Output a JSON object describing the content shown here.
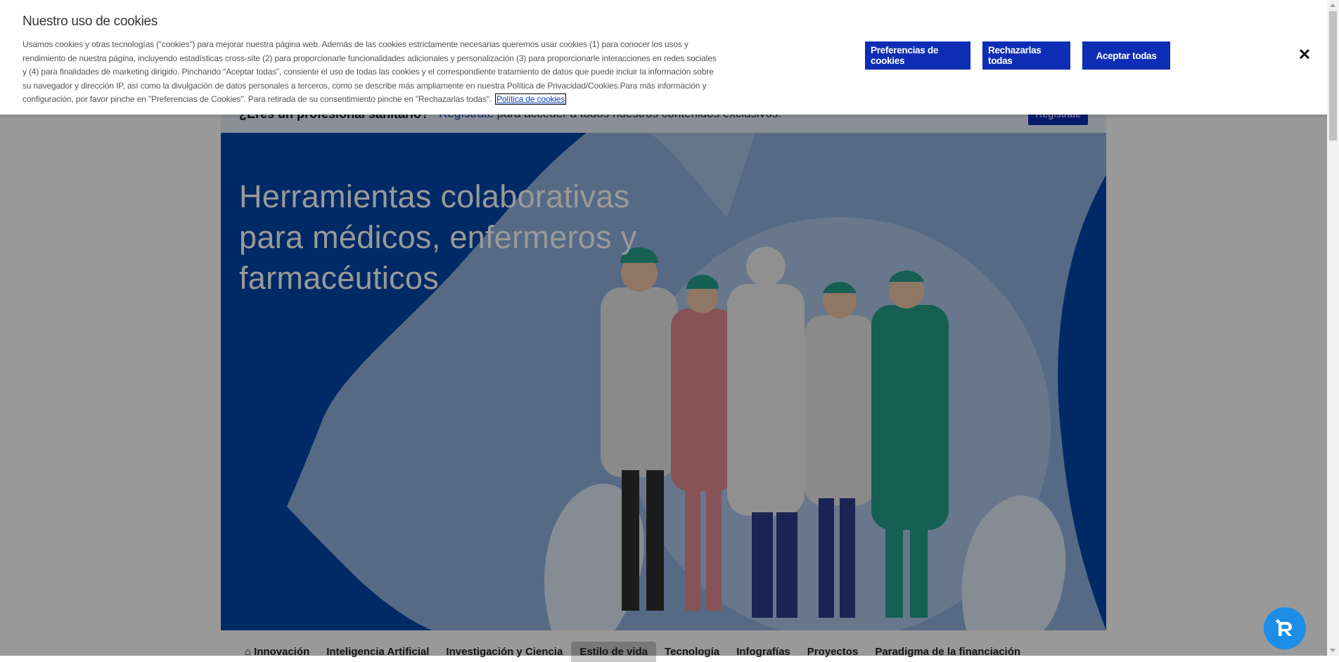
{
  "cookie_banner": {
    "title": "Nuestro uso de cookies",
    "description": "Usamos cookies y otras tecnologías (“cookies”) para mejorar nuestra página web. Además de las cookies estrictamente necesarias queremos usar cookies (1) para conocer los usos y rendimiento de nuestra página, incluyendo estadísticas cross-site (2) para proporcionarle funcionalidades adicionales y personalización (3) para proporcionarle interacciones en redes sociales y (4) para finalidades de marketing dirigido. Pinchando “Aceptar todas”, consiente el uso de todas las cookies y el correspondiente tratamiento de datos que puede incluir la información sobre su navegador y dirección IP, así como la divulgación de datos personales a terceros, como se describe más ampliamente en nuestra Política de Privacidad/Cookies.Para más información y configuración, por favor pinche en \"Preferencias de Cookies\". Para retirada de su consentimiento pinche en \"Rechazarlas todas\".",
    "policy_link": "Política de cookies",
    "preferences_button": "Preferencias de cookies",
    "reject_button": "Rechazarlas todas",
    "accept_button": "Aceptar todas",
    "close_icon": "close-icon"
  },
  "registration_bar": {
    "question": "¿Eres un profesional sanitario?",
    "link": "Regístrate",
    "text": "para acceder a todos nuestros contenidos exclusivos.",
    "button": "Regístrate"
  },
  "hero": {
    "title": "Herramientas colaborativas para médicos, enfermeros y farmacéuticos"
  },
  "nav": {
    "items": [
      {
        "label": "Innovación",
        "icon": "home-icon"
      },
      {
        "label": "Inteligencia Artificial"
      },
      {
        "label": "Investigación y Ciencia"
      },
      {
        "label": "Estilo de vida"
      },
      {
        "label": "Tecnología"
      },
      {
        "label": "Infografías"
      },
      {
        "label": "Proyectos"
      },
      {
        "label": "Paradigma de la financiación"
      }
    ],
    "active_index": 3
  },
  "colors": {
    "brand_blue": "#0d2eb4",
    "hero_dark_blue": "#0047a8",
    "hero_light_blue": "#8fb1e0",
    "fab_blue": "#1c8ee8"
  }
}
